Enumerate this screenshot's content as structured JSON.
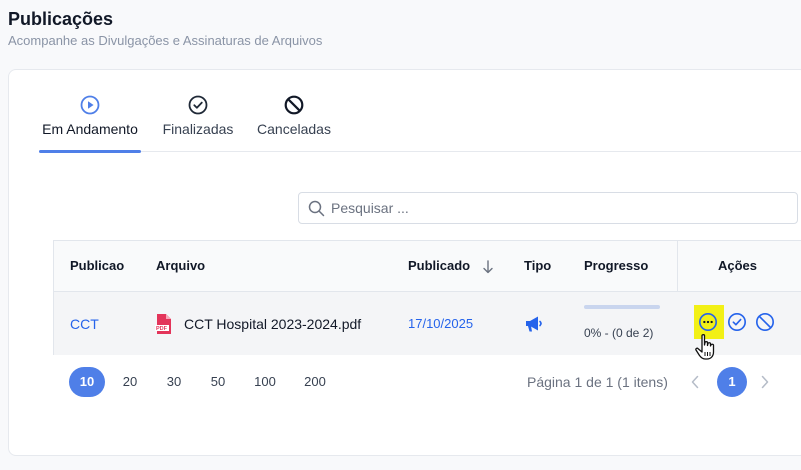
{
  "header": {
    "title": "Publicações",
    "subtitle": "Acompanhe as Divulgações e Assinaturas de Arquivos"
  },
  "tabs": [
    {
      "label": "Em Andamento",
      "icon": "play-circle-icon",
      "active": true
    },
    {
      "label": "Finalizadas",
      "icon": "check-circle-icon",
      "active": false
    },
    {
      "label": "Canceladas",
      "icon": "ban-circle-icon",
      "active": false
    }
  ],
  "search": {
    "placeholder": "Pesquisar ...",
    "value": ""
  },
  "table": {
    "columns": [
      "Publicao",
      "Arquivo",
      "Publicado",
      "Tipo",
      "Progresso",
      "Ações"
    ],
    "sort_column": "Publicado",
    "sort_direction": "desc",
    "rows": [
      {
        "publicacao": "CCT",
        "arquivo": "CCT Hospital 2023-2024.pdf",
        "arquivo_icon": "pdf-file-icon",
        "publicado": "17/10/2025",
        "tipo_icon": "megaphone-icon",
        "progresso_fraction": 0,
        "progresso_text": "0% - (0 de 2)",
        "acoes": [
          "more-options-icon",
          "check-circle-icon",
          "ban-circle-icon"
        ]
      }
    ]
  },
  "pagination": {
    "page_sizes": [
      "10",
      "20",
      "30",
      "50",
      "100",
      "200"
    ],
    "selected_page_size": "10",
    "info": "Página 1 de 1 (1 itens)",
    "current_page": "1"
  },
  "colors": {
    "accent": "#4f7fe8",
    "link": "#2563eb",
    "highlight": "#f2f016",
    "pdf": "#e3345a"
  }
}
